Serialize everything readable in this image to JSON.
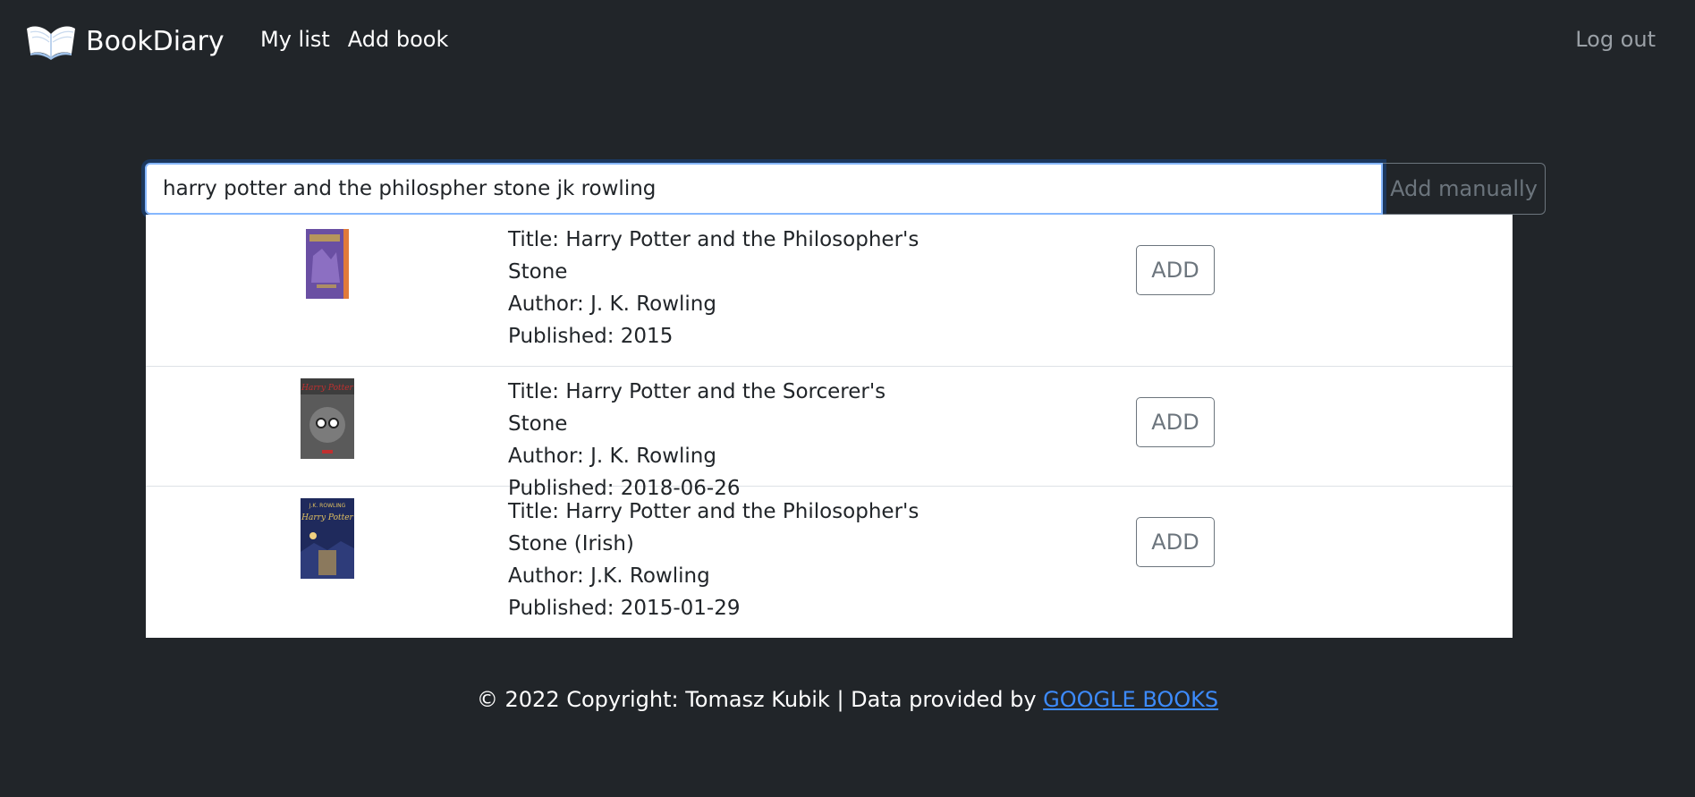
{
  "navbar": {
    "brand": "BookDiary",
    "links": [
      "My list",
      "Add book"
    ],
    "logout": "Log out"
  },
  "search": {
    "value": "harry potter and the philospher stone jk rowling",
    "add_manually_label": "Add manually"
  },
  "results": [
    {
      "title": "Title: Harry Potter and the Philosopher's Stone",
      "author": "Author: J. K. Rowling",
      "published": "Published: 2015",
      "add_label": "ADD"
    },
    {
      "title": "Title: Harry Potter and the Sorcerer's Stone",
      "author": "Author: J. K. Rowling",
      "published": "Published: 2018-06-26",
      "add_label": "ADD"
    },
    {
      "title": "Title: Harry Potter and the Philosopher's Stone (Irish)",
      "author": "Author: J.K. Rowling",
      "published": "Published: 2015-01-29",
      "add_label": "ADD"
    }
  ],
  "footer": {
    "text": "© 2022 Copyright: Tomasz Kubik | Data provided by ",
    "link": "GOOGLE BOOKS"
  },
  "colors": {
    "background": "#212529",
    "link": "#3d8bfd",
    "focus": "#86b7fe"
  }
}
